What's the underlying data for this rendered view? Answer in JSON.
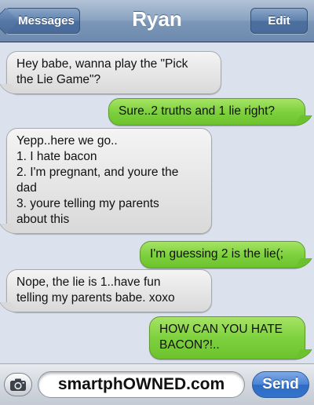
{
  "nav": {
    "back_label": "Messages",
    "title": "Ryan",
    "edit_label": "Edit"
  },
  "messages": [
    {
      "direction": "incoming",
      "lines": [
        "Hey babe, wanna play the \"Pick",
        "the Lie Game\"?"
      ]
    },
    {
      "direction": "outgoing",
      "lines": [
        "Sure..2 truths and 1 lie right?"
      ]
    },
    {
      "direction": "incoming",
      "lines": [
        "Yepp..here we go..",
        "1. I hate bacon",
        "2. I'm pregnant, and youre the",
        "dad",
        "3. youre telling my parents",
        "about this"
      ]
    },
    {
      "direction": "outgoing",
      "lines": [
        "I'm guessing 2 is the lie(;"
      ]
    },
    {
      "direction": "incoming",
      "lines": [
        "Nope, the lie is 1..have fun",
        "telling my parents babe. xoxo"
      ]
    },
    {
      "direction": "outgoing",
      "lines": [
        "HOW CAN YOU HATE",
        "BACON?!.."
      ]
    }
  ],
  "composer": {
    "input_value": "smartphOWNED.com",
    "send_label": "Send",
    "camera_icon": "camera-icon"
  },
  "colors": {
    "outgoing_bubble": "#7ed13e",
    "incoming_bubble": "#e6e6e6",
    "navbar": "#7b96b7",
    "send_button": "#3474cc"
  }
}
